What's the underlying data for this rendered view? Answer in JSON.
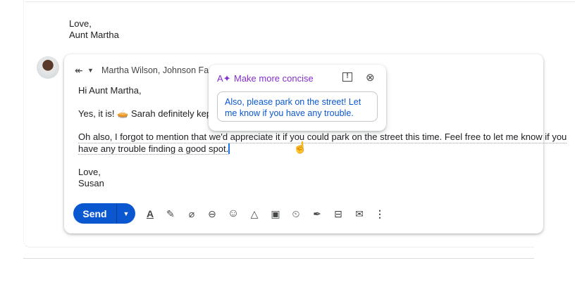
{
  "previous_message": {
    "closing": "Love,",
    "signature": "Aunt Martha"
  },
  "compose": {
    "recipients": "Martha Wilson, Johnson Fami",
    "greeting": "Hi Aunt Martha,",
    "line1": "Yes, it is! 🥧 Sarah definitely kept Ti",
    "para_line1": "Oh also, I forgot to mention that we'd appreciate it if you could park on the street this time. Feel free to let me know if you",
    "para_line2": "have any trouble finding a good spot.",
    "closing": "Love,",
    "signature": "Susan"
  },
  "toolbar": {
    "send_label": "Send",
    "icons": [
      "text-format-icon",
      "magic-pen-icon",
      "attach-icon",
      "link-icon",
      "emoji-icon",
      "drive-icon",
      "photo-icon",
      "confidential-icon",
      "signature-icon",
      "layout-icon",
      "template-icon",
      "more-icon"
    ]
  },
  "popup": {
    "title": "Make more concise",
    "suggestion": "Also, please park on the street! Let me know if you have any trouble.",
    "accent": "#8430ce"
  },
  "colors": {
    "primary": "#0b57d0"
  }
}
